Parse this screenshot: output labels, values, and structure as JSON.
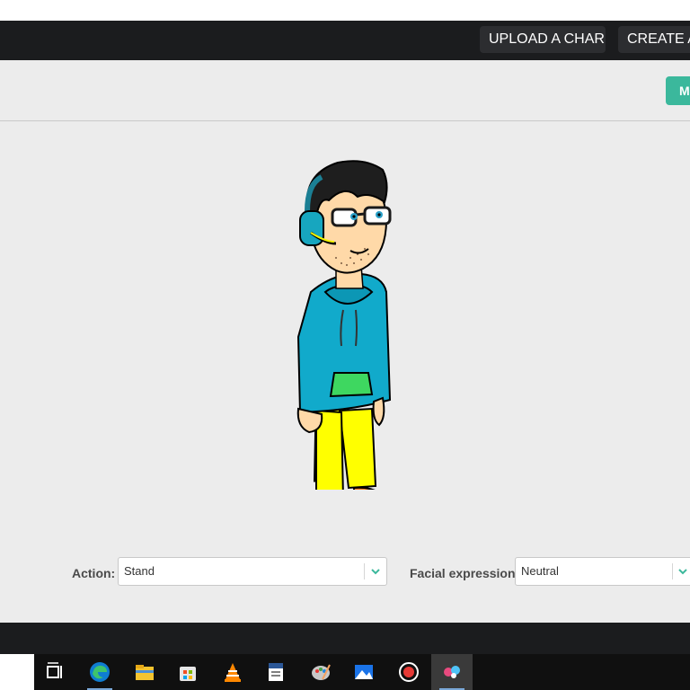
{
  "nav": {
    "upload_label": "UPLOAD A CHAR",
    "create_label": "CREATE A"
  },
  "toolbar": {
    "green_button_label": "M",
    "accent_color": "#3bb89c"
  },
  "controls": {
    "action_label": "Action:",
    "action_value": "Stand",
    "expression_label": "Facial expression:",
    "expression_value": "Neutral"
  },
  "taskbar": {
    "icons": [
      "task-view-icon",
      "edge-icon",
      "file-explorer-icon",
      "store-icon",
      "vlc-icon",
      "word-doc-icon",
      "paint-icon",
      "photos-icon",
      "record-icon",
      "app-icon"
    ]
  }
}
